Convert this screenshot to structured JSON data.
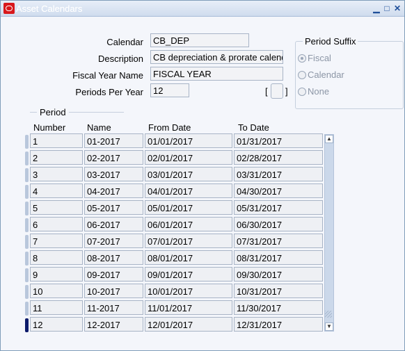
{
  "window": {
    "title": "Asset Calendars",
    "controls": [
      "minimize-icon",
      "maximize-icon",
      "close-icon"
    ]
  },
  "form": {
    "calendar_label": "Calendar",
    "calendar_value": "CB_DEP",
    "description_label": "Description",
    "description_value": "CB depreciation & prorate calendar",
    "fiscal_year_label": "Fiscal Year Name",
    "fiscal_year_value": "FISCAL YEAR",
    "periods_label": "Periods Per Year",
    "periods_value": "12",
    "bracket_left": "[",
    "bracket_right": "]"
  },
  "period_suffix": {
    "title": "Period Suffix",
    "options": [
      "Fiscal",
      "Calendar",
      "None"
    ],
    "selected": "Fiscal"
  },
  "period_table": {
    "group_title": "Period",
    "headers": [
      "Number",
      "Name",
      "From Date",
      "To Date"
    ],
    "rows": [
      [
        "1",
        "01-2017",
        "01/01/2017",
        "01/31/2017"
      ],
      [
        "2",
        "02-2017",
        "02/01/2017",
        "02/28/2017"
      ],
      [
        "3",
        "03-2017",
        "03/01/2017",
        "03/31/2017"
      ],
      [
        "4",
        "04-2017",
        "04/01/2017",
        "04/30/2017"
      ],
      [
        "5",
        "05-2017",
        "05/01/2017",
        "05/31/2017"
      ],
      [
        "6",
        "06-2017",
        "06/01/2017",
        "06/30/2017"
      ],
      [
        "7",
        "07-2017",
        "07/01/2017",
        "07/31/2017"
      ],
      [
        "8",
        "08-2017",
        "08/01/2017",
        "08/31/2017"
      ],
      [
        "9",
        "09-2017",
        "09/01/2017",
        "09/30/2017"
      ],
      [
        "10",
        "10-2017",
        "10/01/2017",
        "10/31/2017"
      ],
      [
        "11",
        "11-2017",
        "11/01/2017",
        "11/30/2017"
      ],
      [
        "12",
        "12-2017",
        "12/01/2017",
        "12/31/2017"
      ]
    ],
    "current_row": 12
  },
  "colors": {
    "title_bar": "#cfdcee",
    "accent": "#1f4f9a",
    "oracle_logo": "#d8181c",
    "field_bg": "#f2f3f6"
  }
}
